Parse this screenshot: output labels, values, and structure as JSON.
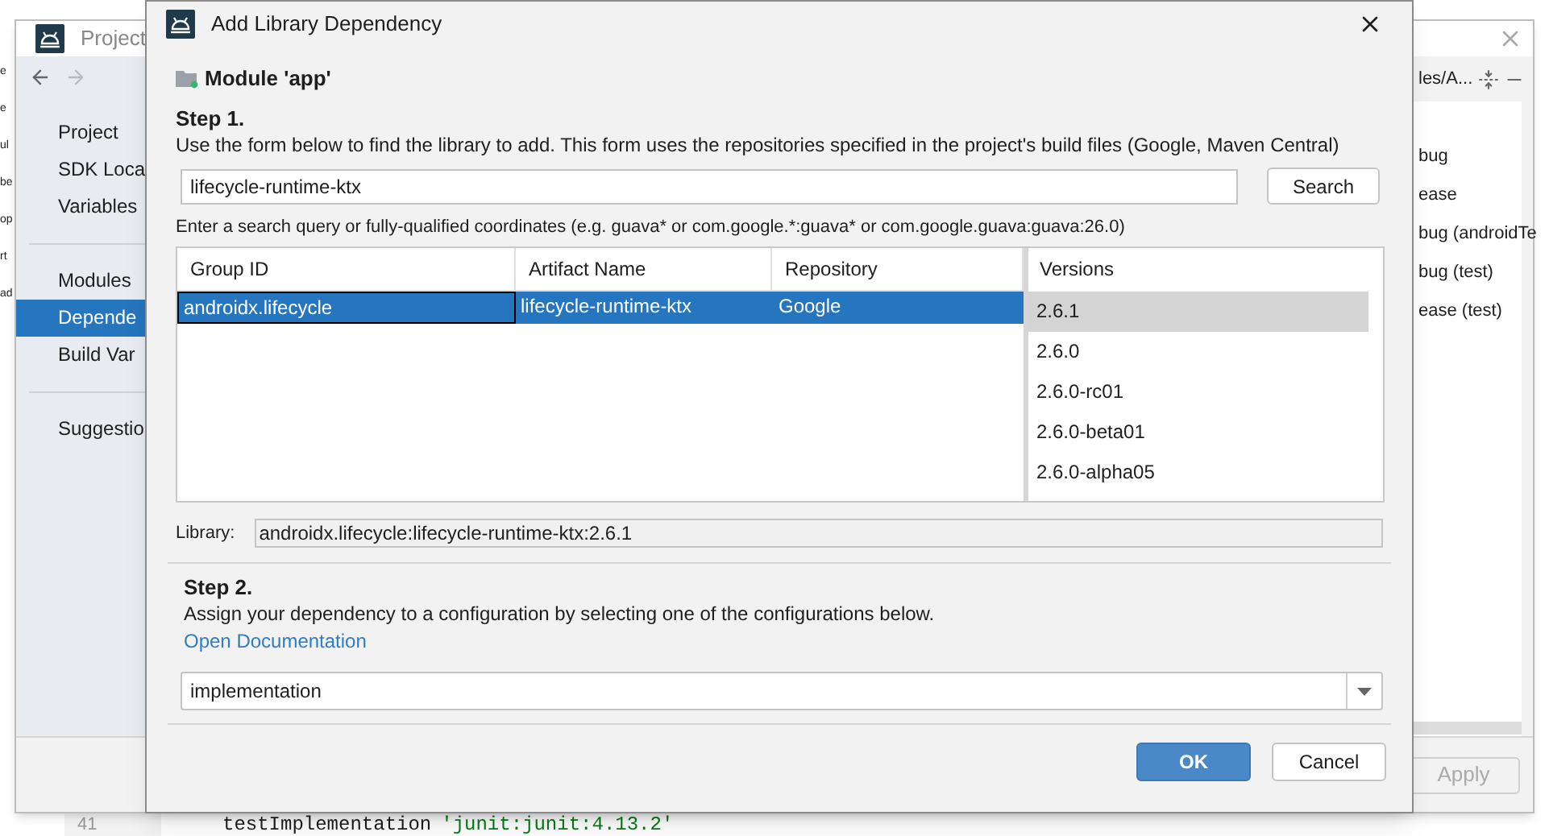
{
  "background_editor": {
    "left_fragments": [
      "e",
      "e",
      "ul",
      "be",
      "op",
      "rt",
      "ad"
    ],
    "line_number": "41",
    "code_keyword": "testImplementation",
    "code_string": "'junit:junit:4.13.2'"
  },
  "back_window": {
    "title": "Project",
    "sidebar_groups": [
      [
        {
          "label": "Project",
          "selected": false
        },
        {
          "label": "SDK Loca",
          "selected": false
        },
        {
          "label": "Variables",
          "selected": false
        }
      ],
      [
        {
          "label": "Modules",
          "selected": false
        },
        {
          "label": "Depende",
          "selected": true
        },
        {
          "label": "Build Var",
          "selected": false
        }
      ],
      [
        {
          "label": "Suggestio",
          "selected": false
        }
      ]
    ],
    "right_panel": {
      "path": "les/A...",
      "items": [
        "bug",
        "ease",
        "bug (androidTe",
        "bug (test)",
        "ease (test)"
      ]
    },
    "apply_button": {
      "label": "Apply",
      "disabled": true
    }
  },
  "dialog": {
    "title": "Add Library Dependency",
    "module": "Module 'app'",
    "step1": {
      "heading": "Step 1.",
      "description": "Use the form below to find the library to add. This form uses the repositories specified in the project's build files (Google, Maven Central)",
      "search_value": "lifecycle-runtime-ktx",
      "search_button": "Search",
      "hint": "Enter a search query or fully-qualified coordinates (e.g. guava* or com.google.*:guava* or com.google.guava:guava:26.0)"
    },
    "table": {
      "columns": [
        "Group ID",
        "Artifact Name",
        "Repository"
      ],
      "rows": [
        {
          "cells": [
            "androidx.lifecycle",
            "lifecycle-runtime-ktx",
            "Google"
          ],
          "selected": true
        }
      ]
    },
    "versions": {
      "heading": "Versions",
      "items": [
        {
          "label": "2.6.1",
          "selected": true
        },
        {
          "label": "2.6.0",
          "selected": false
        },
        {
          "label": "2.6.0-rc01",
          "selected": false
        },
        {
          "label": "2.6.0-beta01",
          "selected": false
        },
        {
          "label": "2.6.0-alpha05",
          "selected": false
        }
      ]
    },
    "library": {
      "label": "Library:",
      "value": "androidx.lifecycle:lifecycle-runtime-ktx:2.6.1"
    },
    "step2": {
      "heading": "Step 2.",
      "description": "Assign your dependency to a configuration by selecting one of the configurations below.",
      "link": "Open Documentation",
      "configuration": "implementation"
    },
    "buttons": [
      {
        "label": "OK",
        "kind": "primary"
      },
      {
        "label": "Cancel",
        "kind": "secondary"
      }
    ]
  }
}
